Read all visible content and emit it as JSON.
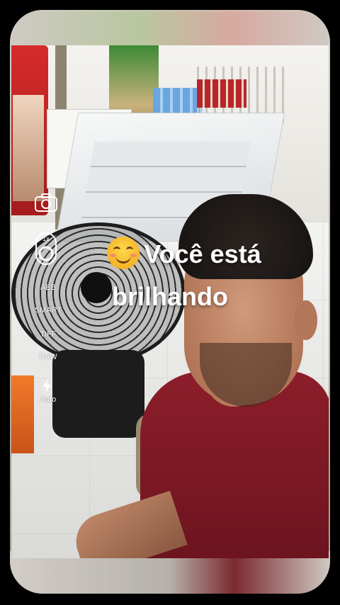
{
  "camera": {
    "lens_label": "1x",
    "modes": {
      "aeb": "AEB",
      "smart": "SMART",
      "tiff": "TIFF",
      "raw": "RAW"
    },
    "flash_mode": "Auto"
  },
  "caption": {
    "emoji": "smiling-face-emoji",
    "line1": "Você está",
    "line2": "brilhando"
  },
  "icons": {
    "camera": "camera-icon",
    "lens": "lens-switch-icon",
    "flash": "flash-icon"
  }
}
